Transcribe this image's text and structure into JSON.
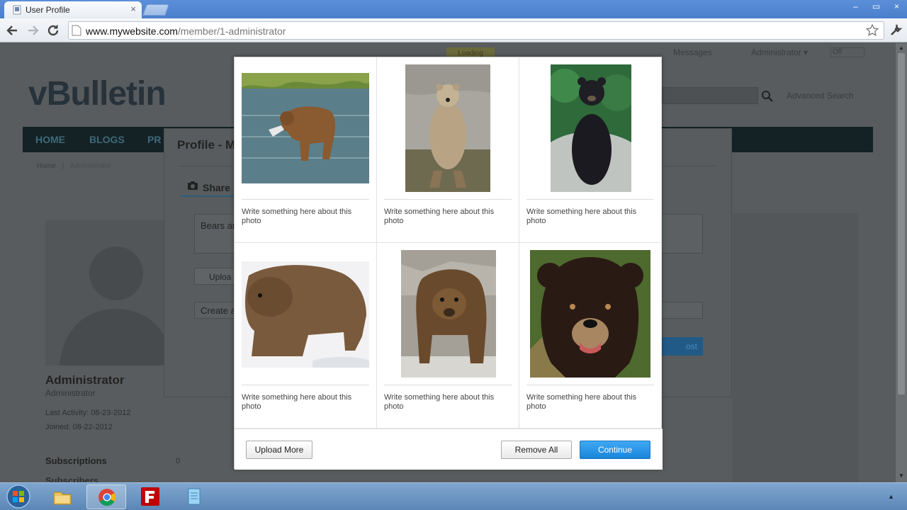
{
  "browser": {
    "tab_title": "User Profile",
    "tab_close": "×",
    "url_host": "www.mywebsite.com",
    "url_path": "/member/1-administrator",
    "window_buttons": [
      "–",
      "▭",
      "×"
    ]
  },
  "page": {
    "loading": "Loading",
    "messages_link": "Messages",
    "user_link": "Administrator ▾",
    "off_toggle": "Off",
    "logo": "vBulletin",
    "advanced_search": "Advanced Search",
    "menu": [
      "HOME",
      "BLOGS",
      "PR"
    ],
    "breadcrumb_home": "Home",
    "breadcrumb_current": "Administrator",
    "profile_name": "Administrator",
    "profile_role": "Administrator",
    "last_activity": "Last Activity: 08-23-2012",
    "joined": "Joined: 08-22-2012",
    "subscriptions": "Subscriptions",
    "subscriptions_count": "0",
    "subscribers": "Subscribers"
  },
  "profile_dialog": {
    "title": "Profile - M",
    "share_tab": "Share",
    "textarea_text": "Bears ar",
    "upload_button": "Uploa",
    "create_field": "Create a",
    "post_button": "ost"
  },
  "photo_modal": {
    "photos": [
      {
        "caption": "Write something here about this photo",
        "subject": "brown bear catching fish in river"
      },
      {
        "caption": "Write something here about this photo",
        "subject": "brown bear standing on hind legs"
      },
      {
        "caption": "Write something here about this photo",
        "subject": "black bear sitting on rock"
      },
      {
        "caption": "Write something here about this photo",
        "subject": "grizzly bear walking in snow"
      },
      {
        "caption": "Write something here about this photo",
        "subject": "grizzly bear walking on rocks"
      },
      {
        "caption": "Write something here about this photo",
        "subject": "black bear face close-up"
      }
    ],
    "upload_more": "Upload More",
    "remove_all": "Remove All",
    "continue": "Continue"
  },
  "taskbar": {
    "items": [
      "windows-start",
      "file-explorer",
      "chrome",
      "filezilla",
      "notepad"
    ]
  }
}
